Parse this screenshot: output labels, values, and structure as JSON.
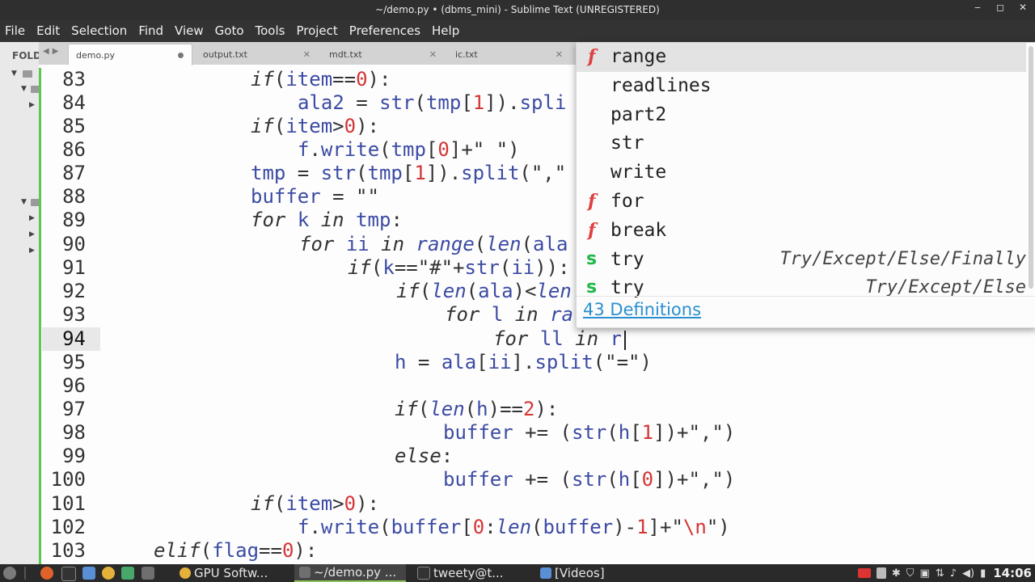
{
  "window": {
    "title": "~/demo.py • (dbms_mini) - Sublime Text (UNREGISTERED)"
  },
  "menu": [
    "File",
    "Edit",
    "Selection",
    "Find",
    "View",
    "Goto",
    "Tools",
    "Project",
    "Preferences",
    "Help"
  ],
  "sidebar": {
    "label": "FOLD"
  },
  "tabs": [
    {
      "label": "demo.py",
      "active": true,
      "modified": true
    },
    {
      "label": "output.txt",
      "active": false
    },
    {
      "label": "mdt.txt",
      "active": false
    },
    {
      "label": "ic.txt",
      "active": false
    }
  ],
  "editor": {
    "current_line": 94,
    "lines": [
      {
        "n": "83"
      },
      {
        "n": "84"
      },
      {
        "n": "85"
      },
      {
        "n": "86"
      },
      {
        "n": "87"
      },
      {
        "n": "88"
      },
      {
        "n": "89"
      },
      {
        "n": "90"
      },
      {
        "n": "91"
      },
      {
        "n": "92"
      },
      {
        "n": "93"
      },
      {
        "n": "94"
      },
      {
        "n": "95"
      },
      {
        "n": "96"
      },
      {
        "n": "97"
      },
      {
        "n": "98"
      },
      {
        "n": "99"
      },
      {
        "n": "100"
      },
      {
        "n": "101"
      },
      {
        "n": "102"
      },
      {
        "n": "103"
      }
    ]
  },
  "autocomplete": {
    "items": [
      {
        "kind": "f",
        "label": "range",
        "hint": "",
        "selected": true
      },
      {
        "kind": "",
        "label": "readlines",
        "hint": ""
      },
      {
        "kind": "",
        "label": "part2",
        "hint": ""
      },
      {
        "kind": "",
        "label": "str",
        "hint": ""
      },
      {
        "kind": "",
        "label": "write",
        "hint": ""
      },
      {
        "kind": "f",
        "label": "for",
        "hint": ""
      },
      {
        "kind": "f",
        "label": "break",
        "hint": ""
      },
      {
        "kind": "s",
        "label": "try",
        "hint": "Try/Except/Else/Finally"
      },
      {
        "kind": "s",
        "label": "try",
        "hint": "Try/Except/Else"
      }
    ],
    "footer": "43 Definitions"
  },
  "taskbar": {
    "tasks": [
      {
        "label": "GPU Softw..."
      },
      {
        "label": "~/demo.py ...",
        "active": true
      },
      {
        "label": "tweety@t..."
      },
      {
        "label": "[Videos]"
      }
    ],
    "clock": "14:06"
  }
}
